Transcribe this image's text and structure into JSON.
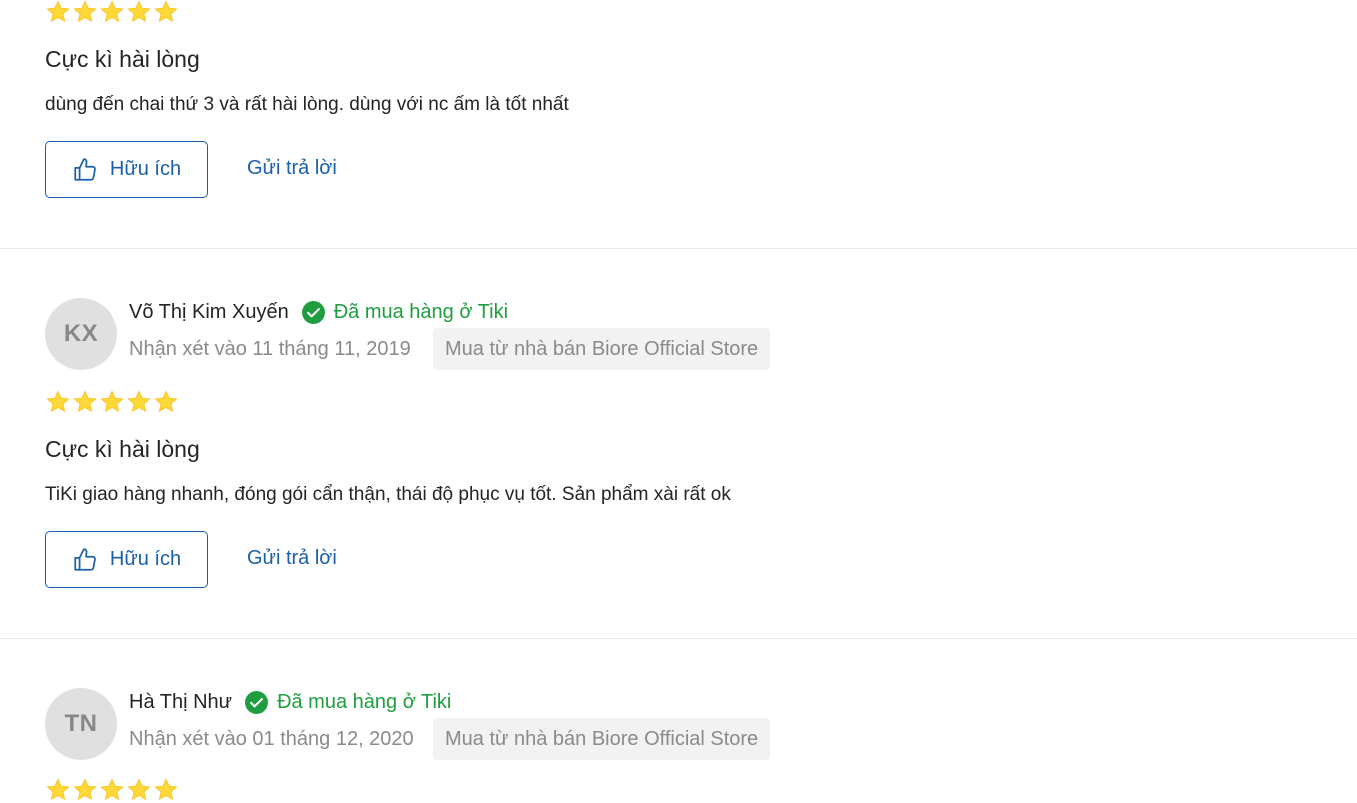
{
  "reviews": [
    {
      "rating": 5,
      "title": "Cực kì hài lòng",
      "content": "dùng đến chai thứ 3 và rất hài lòng. dùng với nc ấm là tốt nhất",
      "helpful_label": "Hữu ích",
      "reply_label": "Gửi trả lời"
    },
    {
      "avatar_initials": "KX",
      "name": "Võ Thị Kim Xuyến",
      "verified_label": "Đã mua hàng ở Tiki",
      "date": "Nhận xét vào 11 tháng 11, 2019",
      "seller": "Mua từ nhà bán Biore Official Store",
      "rating": 5,
      "title": "Cực kì hài lòng",
      "content": "TiKi giao hàng nhanh, đóng gói cẩn thận, thái độ phục vụ tốt. Sản phẩm xài rất ok",
      "helpful_label": "Hữu ích",
      "reply_label": "Gửi trả lời"
    },
    {
      "avatar_initials": "TN",
      "name": "Hà Thị Như",
      "verified_label": "Đã mua hàng ở Tiki",
      "date": "Nhận xét vào 01 tháng 12, 2020",
      "seller": "Mua từ nhà bán Biore Official Store",
      "rating": 5
    }
  ],
  "colors": {
    "star": "#fdd836",
    "verified": "#1e9e3f",
    "link": "#1a5fa8"
  },
  "icons": {
    "star": "star-icon",
    "thumbs_up": "thumbs-up-icon",
    "verified": "check-circle-icon"
  }
}
